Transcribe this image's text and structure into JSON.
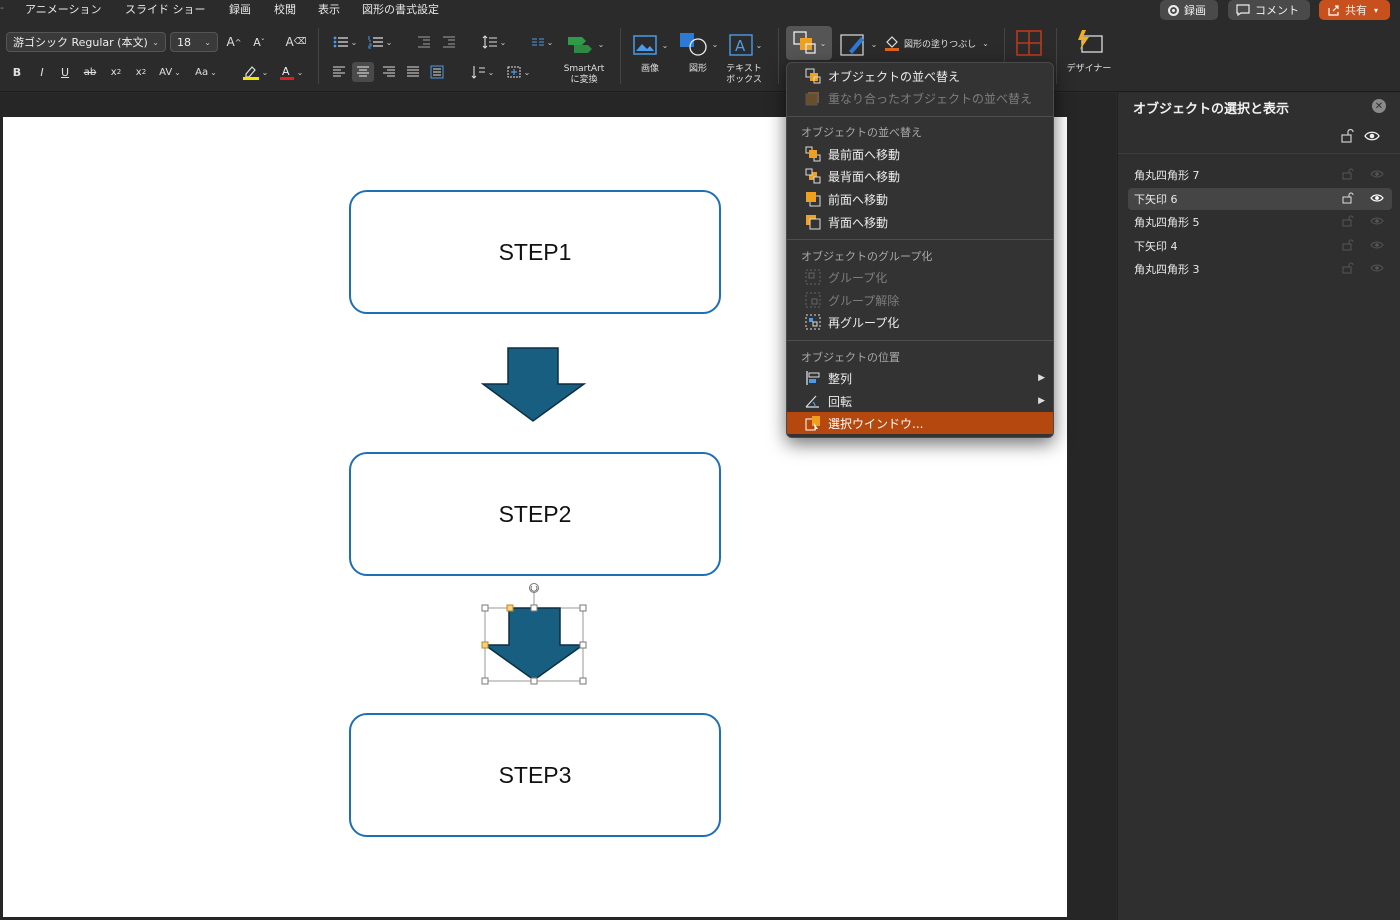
{
  "tabs": {
    "animation": "アニメーション",
    "slideshow": "スライド ショー",
    "record": "録画",
    "review": "校閲",
    "view": "表示",
    "shape_format": "図形の書式設定"
  },
  "top_buttons": {
    "record": "録画",
    "comment": "コメント",
    "share": "共有"
  },
  "ribbon": {
    "font_name": "游ゴシック Regular (本文)",
    "font_size": "18",
    "smartart": "SmartArt\nに変換",
    "image": "画像",
    "shape": "図形",
    "textbox": "テキスト\nボックス",
    "shape_fill": "図形の塗りつぶし",
    "designer": "デザイナー"
  },
  "slide": {
    "step1": "STEP1",
    "step2": "STEP2",
    "step3": "STEP3"
  },
  "pane": {
    "title": "オブジェクトの選択と表示",
    "items": [
      {
        "label": "角丸四角形 7",
        "selected": false
      },
      {
        "label": "下矢印 6",
        "selected": true
      },
      {
        "label": "角丸四角形 5",
        "selected": false
      },
      {
        "label": "下矢印 4",
        "selected": false
      },
      {
        "label": "角丸四角形 3",
        "selected": false
      }
    ]
  },
  "menu": {
    "reorder_objects": "オブジェクトの並べ替え",
    "reorder_overlapping": "重なり合ったオブジェクトの並べ替え",
    "header_reorder": "オブジェクトの並べ替え",
    "bring_to_front": "最前面へ移動",
    "send_to_back": "最背面へ移動",
    "bring_forward": "前面へ移動",
    "send_backward": "背面へ移動",
    "header_group": "オブジェクトのグループ化",
    "group": "グループ化",
    "ungroup": "グループ解除",
    "regroup": "再グループ化",
    "header_position": "オブジェクトの位置",
    "align": "整列",
    "rotate": "回転",
    "selection_pane": "選択ウインドウ..."
  },
  "colors": {
    "accent_orange": "#b4480f",
    "arrow_fill": "#175e80",
    "box_border": "#1f6fb5"
  }
}
